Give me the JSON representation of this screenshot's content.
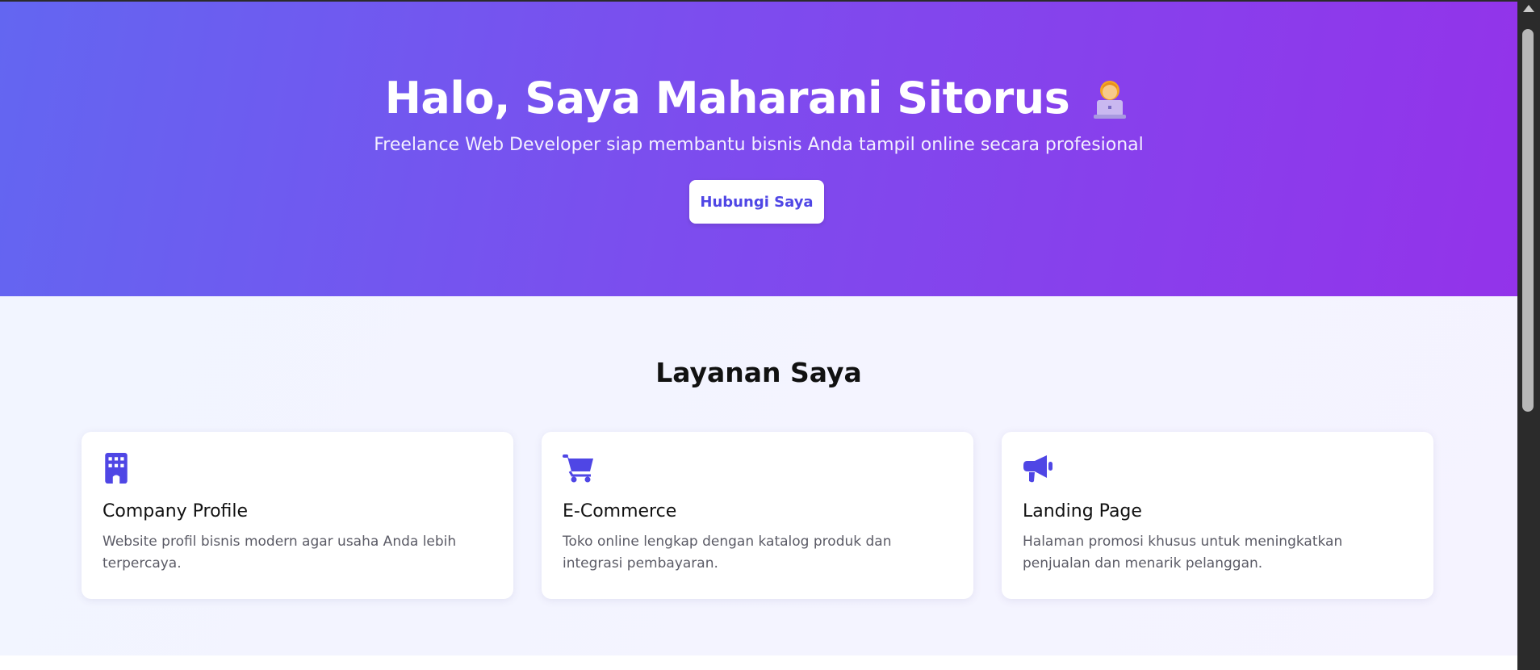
{
  "hero": {
    "title": "Halo, Saya Maharani Sitorus",
    "title_emoji_icon": "woman-technologist-emoji",
    "subtitle": "Freelance Web Developer siap membantu bisnis Anda tampil online secara profesional",
    "cta_label": "Hubungi Saya",
    "gradient": [
      "#6366f1",
      "#9333ea"
    ]
  },
  "services": {
    "title": "Layanan Saya",
    "accent": "#4f46e5",
    "cards": [
      {
        "icon": "building-icon",
        "title": "Company Profile",
        "desc": "Website profil bisnis modern agar usaha Anda lebih terpercaya."
      },
      {
        "icon": "shopping-cart-icon",
        "title": "E-Commerce",
        "desc": "Toko online lengkap dengan katalog produk dan integrasi pembayaran."
      },
      {
        "icon": "megaphone-icon",
        "title": "Landing Page",
        "desc": "Halaman promosi khusus untuk meningkatkan penjualan dan menarik pelanggan."
      }
    ]
  }
}
